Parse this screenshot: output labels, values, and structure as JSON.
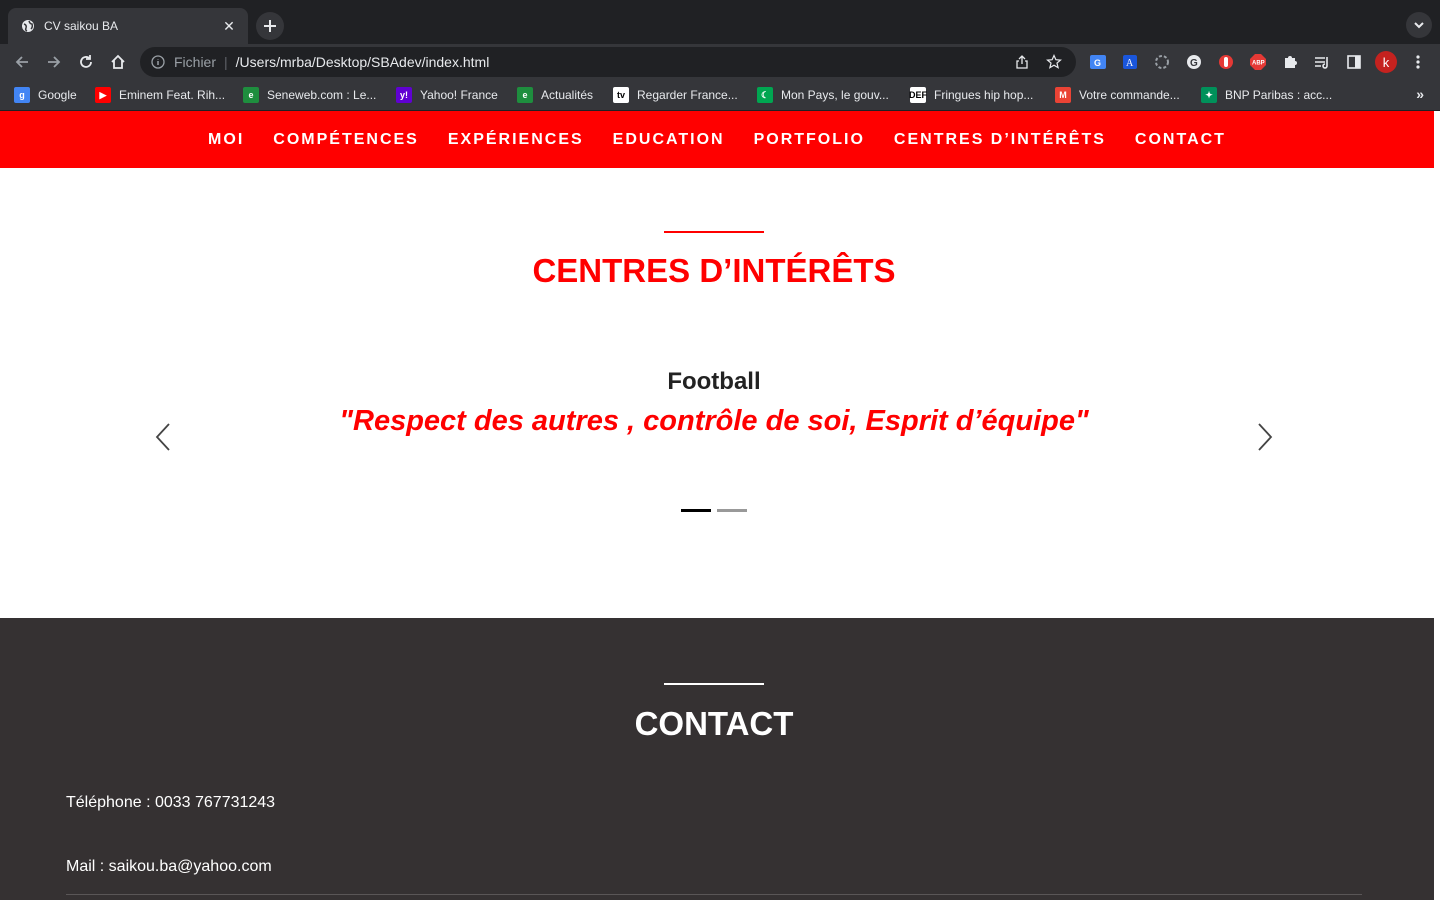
{
  "browser": {
    "tab_title": "CV saikou BA",
    "scheme_label": "Fichier",
    "url": "/Users/mrba/Desktop/SBAdev/index.html",
    "profile_initial": "k",
    "bookmarks": [
      {
        "label": "Google",
        "icon": "google-icon",
        "color": "#4285f4",
        "glyph": "g"
      },
      {
        "label": "Eminem Feat. Rih...",
        "icon": "youtube-icon",
        "color": "#ff0000",
        "glyph": "▶"
      },
      {
        "label": "Seneweb.com : Le...",
        "icon": "seneweb-icon",
        "color": "#1e8e3e",
        "glyph": "e"
      },
      {
        "label": "Yahoo! France",
        "icon": "yahoo-icon",
        "color": "#6001d2",
        "glyph": "y!"
      },
      {
        "label": "Actualités",
        "icon": "seneweb-icon",
        "color": "#1e8e3e",
        "glyph": "e"
      },
      {
        "label": "Regarder France...",
        "icon": "tv-icon",
        "color": "#ffffff",
        "glyph": "tv"
      },
      {
        "label": "Mon Pays, le gouv...",
        "icon": "flag-icon",
        "color": "#00a651",
        "glyph": "☾"
      },
      {
        "label": "Fringues hip hop...",
        "icon": "def-icon",
        "color": "#ffffff",
        "glyph": "DEF"
      },
      {
        "label": "Votre commande...",
        "icon": "gmail-icon",
        "color": "#ea4335",
        "glyph": "M"
      },
      {
        "label": "BNP Paribas : acc...",
        "icon": "bnp-icon",
        "color": "#00915a",
        "glyph": "✦"
      }
    ]
  },
  "site": {
    "accent": "#ff0000",
    "nav": [
      "MOI",
      "COMPÉTENCES",
      "EXPÉRIENCES",
      "EDUCATION",
      "PORTFOLIO",
      "CENTRES D’INTÉRÊTS",
      "CONTACT"
    ],
    "interests": {
      "title": "CENTRES D’INTÉRÊTS",
      "slide_title": "Football",
      "slide_quote": "\"Respect des autres , contrôle de soi, Esprit d’équipe\"",
      "slide_count": 2,
      "active_slide": 1
    },
    "contact": {
      "title": "CONTACT",
      "phone": "Téléphone : 0033 767731243",
      "mail": "Mail : saikou.ba@yahoo.com"
    }
  }
}
